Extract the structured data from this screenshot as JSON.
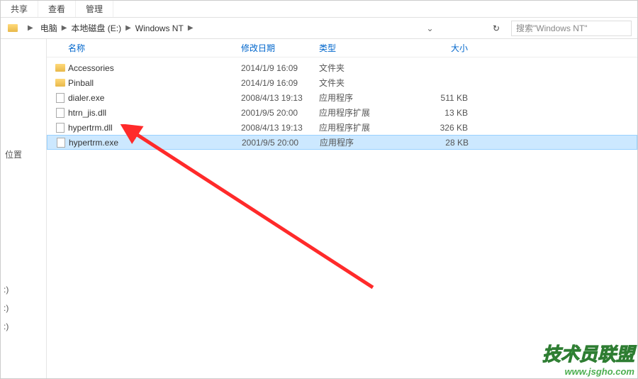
{
  "tabs": {
    "share": "共享",
    "view": "查看",
    "manage": "管理"
  },
  "breadcrumb": {
    "computer": "电脑",
    "disk": "本地磁盘 (E:)",
    "folder": "Windows NT"
  },
  "search": {
    "placeholder": "搜索\"Windows NT\""
  },
  "side": {
    "location": "位置"
  },
  "columns": {
    "name": "名称",
    "date": "修改日期",
    "type": "类型",
    "size": "大小"
  },
  "files": [
    {
      "name": "Accessories",
      "date": "2014/1/9 16:09",
      "type": "文件夹",
      "size": "",
      "kind": "folder"
    },
    {
      "name": "Pinball",
      "date": "2014/1/9 16:09",
      "type": "文件夹",
      "size": "",
      "kind": "folder"
    },
    {
      "name": "dialer.exe",
      "date": "2008/4/13 19:13",
      "type": "应用程序",
      "size": "511 KB",
      "kind": "exe"
    },
    {
      "name": "htrn_jis.dll",
      "date": "2001/9/5 20:00",
      "type": "应用程序扩展",
      "size": "13 KB",
      "kind": "dll"
    },
    {
      "name": "hypertrm.dll",
      "date": "2008/4/13 19:13",
      "type": "应用程序扩展",
      "size": "326 KB",
      "kind": "dll"
    },
    {
      "name": "hypertrm.exe",
      "date": "2001/9/5 20:00",
      "type": "应用程序",
      "size": "28 KB",
      "kind": "exe",
      "selected": true
    }
  ],
  "watermark": {
    "line1": "技术员联盟",
    "line2": "www.jsgho.com"
  }
}
